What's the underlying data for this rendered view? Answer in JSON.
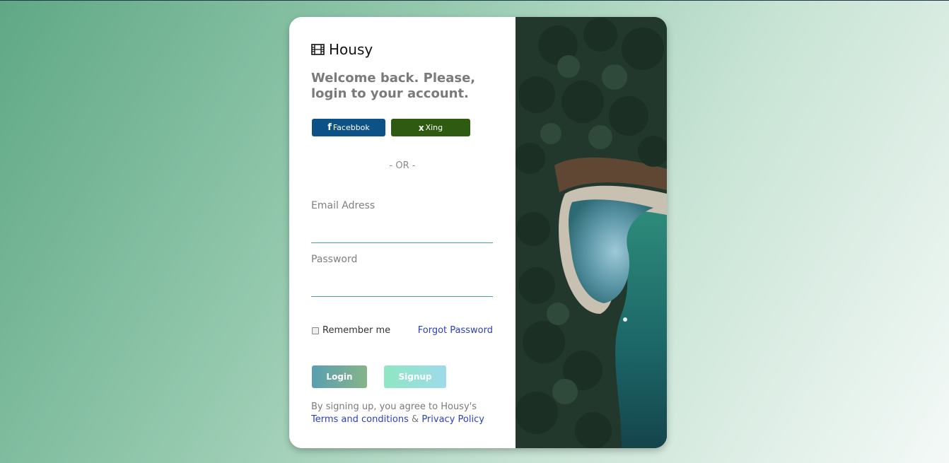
{
  "brand": {
    "name": "Housy",
    "icon": "film-icon"
  },
  "welcome": {
    "text": "Welcome back. Please, login to your account."
  },
  "social": {
    "facebook": {
      "label": "Facebbok",
      "icon": "f",
      "color": "#0d5286"
    },
    "xing": {
      "label": "Xing",
      "icon": "x",
      "color": "#2f5a12"
    }
  },
  "divider": {
    "text": "- OR -"
  },
  "form": {
    "email_label": "Email Adress",
    "password_label": "Password",
    "remember_label": "Remember me",
    "forgot_label": "Forgot Password"
  },
  "buttons": {
    "login": "Login",
    "signup": "Signup"
  },
  "terms": {
    "prefix": "By signing up, you agree to Housy's",
    "terms_link": "Terms and conditions",
    "amp": "&",
    "privacy_link": "Privacy Policy"
  },
  "colors": {
    "accent_link": "#2a3fc4",
    "field_line": "#4a9dc2"
  }
}
